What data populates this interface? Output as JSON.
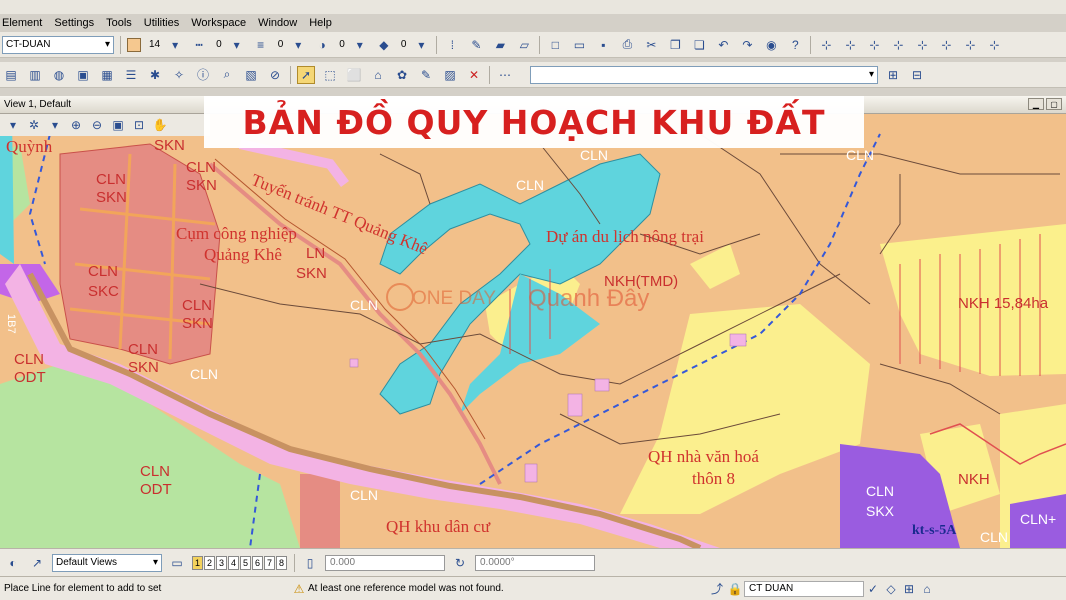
{
  "menu": [
    "Element",
    "Settings",
    "Tools",
    "Utilities",
    "Workspace",
    "Window",
    "Help"
  ],
  "level_combo": "CT-DUAN",
  "color_value": "14",
  "style_value": "0",
  "weight_value": "0",
  "transparency_value": "0",
  "priority_value": "0",
  "view_title": "View 1, Default",
  "banner_title": "BẢN ĐỒ QUY HOẠCH KHU ĐẤT",
  "watermark_one": "ONE DAY",
  "watermark_brand": "Quanh Đây",
  "map_labels": {
    "quynh": "Quỳnh",
    "skn_top": "SKN",
    "cln_1": "CLN",
    "skn_1": "SKN",
    "cln_2": "CLN",
    "skn_2": "SKN",
    "tuyen": "Tuyến tránh TT Quảng Khê",
    "cum1": "Cụm công nghiệp",
    "cum2": "Quảng Khê",
    "cln_skn_ln": "LN",
    "skn_3": "SKN",
    "cln_3": "CLN",
    "skc": "SKC",
    "cln_4": "CLN",
    "skn_4": "SKN",
    "cln_5": "CLN",
    "skn_5": "SKN",
    "cln_odt": "CLN",
    "odt": "ODT",
    "cln_mid": "CLN",
    "cln_a": "CLN",
    "cln_b": "CLN",
    "cln_top1": "CLN",
    "cln_top2": "CLN",
    "cln_top3": "CLN",
    "duan": "Dự án du lịch nông trại",
    "nkh_tmd": "NKH(TMD)",
    "nkh_big": "NKH 15,84ha",
    "qh_nha": "QH nhà văn hoá",
    "thon8": "thôn 8",
    "cln_odt2": "CLN",
    "odt2": "ODT",
    "qh_khu": "QH khu dân cư",
    "cln_skx": "CLN",
    "skx": "SKX",
    "nkh_r": "NKH",
    "kts": "kt-s-5A",
    "cln_r": "CLN",
    "cln_plus": "CLN+",
    "cln_bot": "CLN",
    "route": "1B7"
  },
  "status": {
    "views_combo": "Default Views",
    "pages": [
      "1",
      "2",
      "3",
      "4",
      "5",
      "6",
      "7",
      "8"
    ],
    "coord_x": "0.000",
    "coord_angle": "0.0000°",
    "prompt": "Place Line for element to add to set",
    "warning": "At least one reference model was not found.",
    "active_level": "CT DUAN"
  },
  "colors": {
    "orange_land": "#f2c08a",
    "red_land": "#e38e84",
    "road_pink": "#f3b3e4",
    "water": "#5fd4dd",
    "green_forest": "#b9e6a3",
    "yellow": "#fbf08c",
    "purple": "#9a5ce0",
    "banner_red": "#d7201f"
  }
}
